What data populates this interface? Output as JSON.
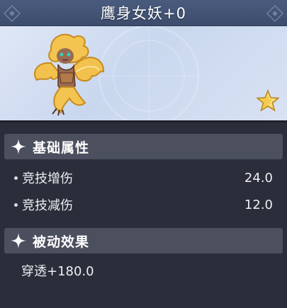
{
  "header": {
    "title": "鹰身女妖+0"
  },
  "portrait": {
    "creature_icon": "harpy-creature-icon",
    "badge_icon": "star-icon",
    "badge_color": "#f5cc4a"
  },
  "sections": {
    "basic": {
      "label": "基础属性",
      "icon": "sparkle-icon",
      "stats": [
        {
          "name": "竞技增伤",
          "value": "24.0"
        },
        {
          "name": "竞技减伤",
          "value": "12.0"
        }
      ]
    },
    "passive": {
      "label": "被动效果",
      "icon": "sparkle-icon",
      "text": "穿透+180.0"
    }
  },
  "colors": {
    "title_bar": "#445576",
    "panel_bg": "#2b2e3a",
    "section_header_bg": "#4b4f5e",
    "portrait_bg": "#d6e0f1"
  }
}
